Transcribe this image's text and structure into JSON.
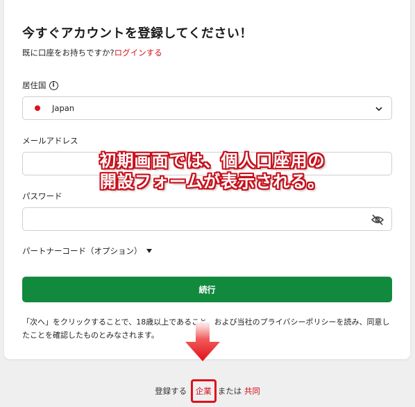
{
  "form": {
    "title": "今すぐアカウントを登録してください！",
    "login_prompt": "既に口座をお持ちですか?",
    "login_link": "ログインする",
    "residence_label": "居住国",
    "residence_value": "Japan",
    "email_label": "メールアドレス",
    "email_value": "",
    "password_label": "パスワード",
    "password_value": "",
    "partner_label": "パートナーコード（オプション）",
    "continue_label": "続行",
    "disclaimer": "「次へ」をクリックすることで、18歳以上であること、および当社のプライバシーポリシーを読み、同意したことを確認したものとみなされます。"
  },
  "annotation": {
    "line1": "初期画面では、個人口座用の",
    "line2": "開設フォームが表示される。"
  },
  "footer": {
    "prefix": "登録する",
    "corporate": "企業",
    "middle": "または",
    "joint": "共同"
  },
  "colors": {
    "accent_red": "#d0121b",
    "button_green": "#128a3e",
    "annotation_red": "#e0101a"
  },
  "icons": [
    "info-icon",
    "chevron-down-icon",
    "eye-slash-icon",
    "caret-down-icon",
    "arrow-down-icon"
  ]
}
